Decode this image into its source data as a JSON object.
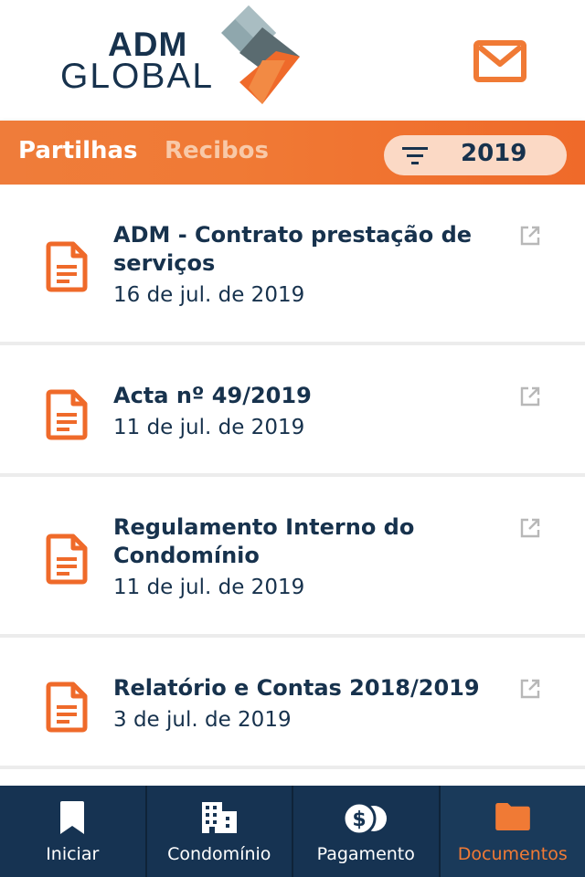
{
  "header": {
    "logo_line1": "ADM",
    "logo_line2": "GLOBAL"
  },
  "tabs": {
    "partilhas": "Partilhas",
    "recibos": "Recibos"
  },
  "filter": {
    "year": "2019"
  },
  "documents": [
    {
      "title": "ADM - Contrato prestação de serviços",
      "date": "16 de jul. de 2019"
    },
    {
      "title": "Acta nº 49/2019",
      "date": "11 de jul. de 2019"
    },
    {
      "title": "Regulamento Interno do Condomínio",
      "date": "11 de jul. de 2019"
    },
    {
      "title": "Relatório e Contas 2018/2019",
      "date": "3 de jul. de 2019"
    }
  ],
  "bottom_nav": {
    "iniciar": "Iniciar",
    "condominio": "Condomínio",
    "pagamento": "Pagamento",
    "documentos": "Documentos"
  },
  "colors": {
    "accent": "#f07a35",
    "navy": "#17324d",
    "logo_gray": "#8fa7ad"
  }
}
